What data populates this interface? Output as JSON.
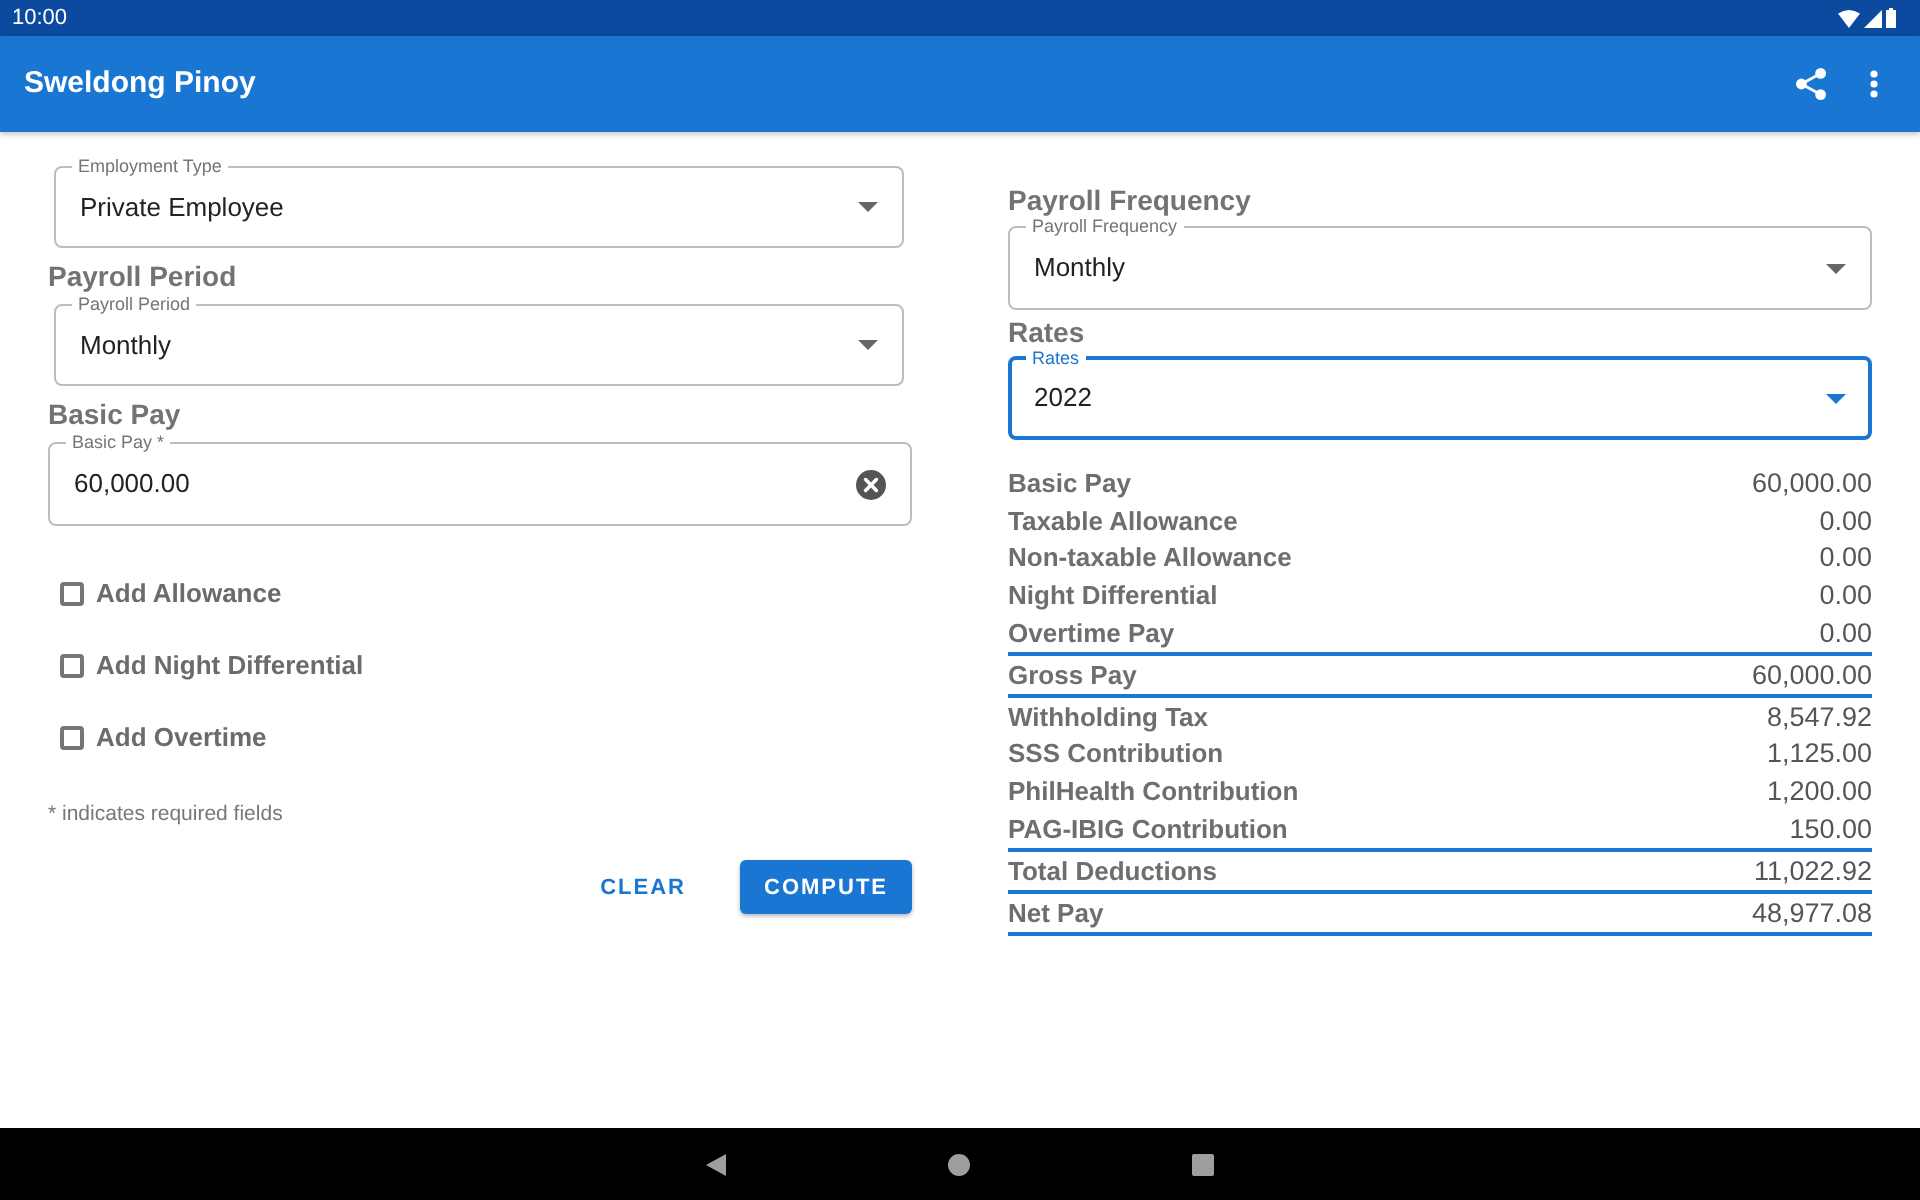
{
  "status_bar": {
    "time": "10:00"
  },
  "app_bar": {
    "title": "Sweldong Pinoy"
  },
  "form": {
    "fields": [
      {
        "kind": "select",
        "label": "Employment Type",
        "value": "Private Employee",
        "focused": false
      },
      {
        "kind": "select",
        "heading": "Payroll Period",
        "label": "Payroll Period",
        "value": "Monthly",
        "focused": false
      },
      {
        "kind": "text",
        "heading": "Basic Pay",
        "label": "Basic Pay *",
        "value": "60,000.00",
        "focused": false
      }
    ],
    "checkboxes": [
      {
        "label": "Add Allowance",
        "checked": false
      },
      {
        "label": "Add Night Differential",
        "checked": false
      },
      {
        "label": "Add Overtime",
        "checked": false
      }
    ],
    "note": "* indicates required fields",
    "buttons": [
      {
        "kind": "text",
        "label": "CLEAR"
      },
      {
        "kind": "contained",
        "label": "COMPUTE"
      }
    ]
  },
  "settings": {
    "fields": [
      {
        "kind": "select",
        "heading": "Payroll Frequency",
        "label": "Payroll Frequency",
        "value": "Monthly",
        "focused": false
      },
      {
        "kind": "select",
        "heading": "Rates",
        "label": "Rates",
        "value": "2022",
        "focused": true
      }
    ]
  },
  "summary": {
    "sections": [
      {
        "rows": [
          {
            "label": "Basic Pay",
            "value": "60,000.00"
          },
          {
            "label": "Taxable Allowance",
            "value": "0.00"
          },
          {
            "label": "Non-taxable Allowance",
            "value": "0.00"
          },
          {
            "label": "Night Differential",
            "value": "0.00"
          },
          {
            "label": "Overtime Pay",
            "value": "0.00"
          }
        ]
      },
      {
        "rows": [
          {
            "label": "Gross Pay",
            "value": "60,000.00"
          }
        ]
      },
      {
        "rows": [
          {
            "label": "Withholding Tax",
            "value": "8,547.92"
          },
          {
            "label": "SSS Contribution",
            "value": "1,125.00"
          },
          {
            "label": "PhilHealth Contribution",
            "value": "1,200.00"
          },
          {
            "label": "PAG-IBIG Contribution",
            "value": "150.00"
          }
        ]
      },
      {
        "rows": [
          {
            "label": "Total Deductions",
            "value": "11,022.92"
          }
        ]
      },
      {
        "rows": [
          {
            "label": "Net Pay",
            "value": "48,977.08"
          }
        ]
      }
    ]
  }
}
